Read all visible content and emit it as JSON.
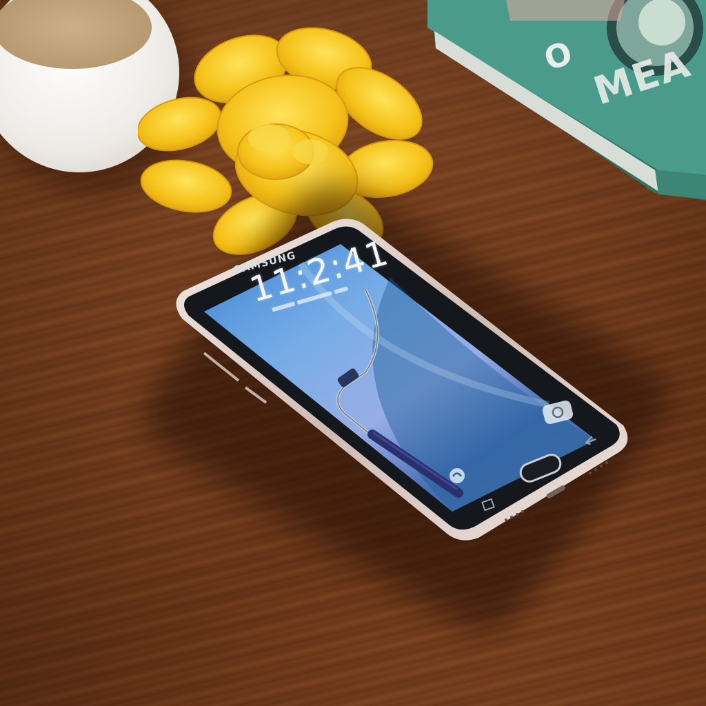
{
  "phone": {
    "brand": "SAMSUNG",
    "lock_time": "11:2:41"
  },
  "book": {
    "title_letter": "O",
    "title_word": "MEA"
  },
  "colors": {
    "table": "#7a4220",
    "flower": "#f5c518",
    "book_cover": "#4a9b8a",
    "phone_frame": "#d8c8c0",
    "screen_blue": "#2f7fc6"
  },
  "icons": [
    "camera-icon",
    "shortcut-icon",
    "home-button",
    "back-icon",
    "recent-apps-icon",
    "stylus-icon"
  ]
}
